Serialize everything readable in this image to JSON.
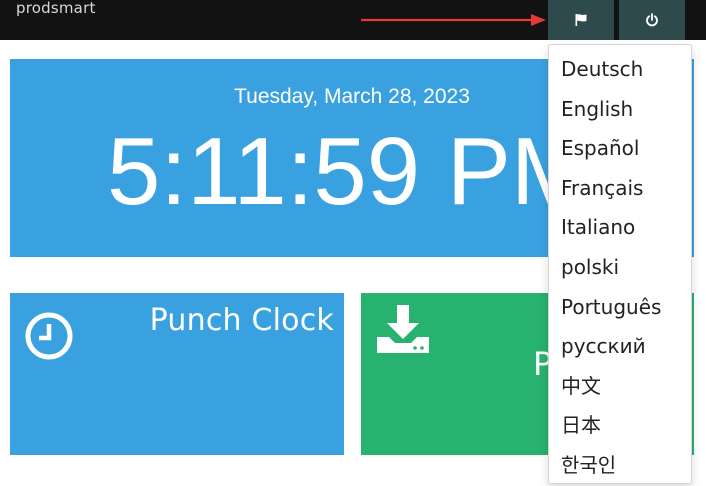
{
  "header": {
    "brand": "prodsmart",
    "flag_icon": "flag-icon",
    "power_icon": "power-icon",
    "accent": "#2f4a4c"
  },
  "clock": {
    "date": "Tuesday, March 28, 2023",
    "time": "5:11:59 PM",
    "color": "#3aa1e0"
  },
  "tiles": {
    "punch_clock": {
      "label": "Punch Clock",
      "icon": "clock-icon",
      "color": "#3aa1e0"
    },
    "download": {
      "label_partial": "P",
      "icon": "download-icon",
      "color": "#27b26f"
    }
  },
  "language_menu": {
    "items": [
      "Deutsch",
      "English",
      "Español",
      "Français",
      "Italiano",
      "polski",
      "Português",
      "русский",
      "中文",
      "日本",
      "한국인"
    ]
  },
  "annotation": {
    "arrow_color": "#e53935"
  }
}
